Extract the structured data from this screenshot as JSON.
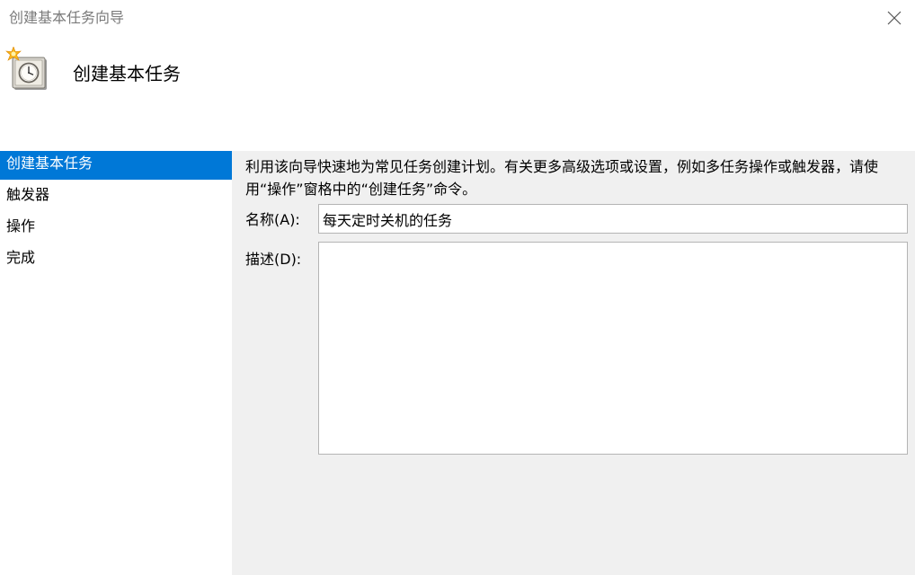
{
  "window": {
    "title": "创建基本任务向导",
    "close_label": "×"
  },
  "header": {
    "title": "创建基本任务",
    "icon": "scheduled-task-clock-icon"
  },
  "sidebar": {
    "items": [
      {
        "label": "创建基本任务",
        "selected": true
      },
      {
        "label": "触发器",
        "selected": false
      },
      {
        "label": "操作",
        "selected": false
      },
      {
        "label": "完成",
        "selected": false
      }
    ]
  },
  "main": {
    "description": "利用该向导快速地为常见任务创建计划。有关更多高级选项或设置，例如多任务操作或触发器，请使用“操作”窗格中的“创建任务”命令。",
    "name_label": "名称(A):",
    "name_value": "每天定时关机的任务",
    "desc_label": "描述(D):",
    "desc_value": ""
  },
  "colors": {
    "accent": "#0078d7",
    "window_bg": "#f0f0f0",
    "panel_bg": "#ffffff",
    "title_text": "#7a7a7a",
    "input_border": "#b4b4b4"
  }
}
